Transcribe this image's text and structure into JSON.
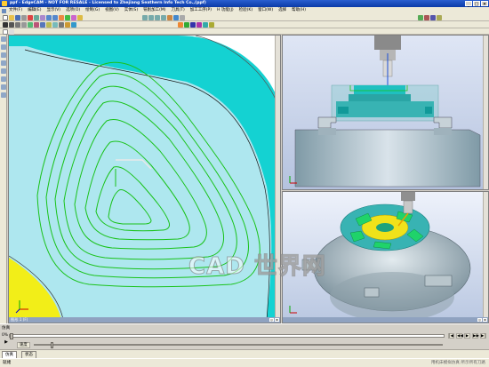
{
  "window": {
    "title": "ppf - EdgeCAM - NOT FOR RESALE - Licensed to Zhejiang Seathern Info Tech Co.,(ppf)",
    "controls": [
      "_",
      "□",
      "×"
    ]
  },
  "menubar": {
    "items": [
      "文件(F)",
      "编辑(E)",
      "显示(V)",
      "选项(O)",
      "绘制(G)",
      "视图(V)",
      "实体(S)",
      "铣削加工(M)",
      "刀具(T)",
      "加工工序(P)",
      "H 功能(J)",
      "检验(K)",
      "窗口(W)",
      "选择",
      "帮助(H)"
    ]
  },
  "viewports": {
    "left_label": "图形 1 (F)",
    "right_top_label": "",
    "right_bottom_label": ""
  },
  "simulation": {
    "title": "仿真",
    "progress_percent": "0%",
    "speed_label": "速度",
    "progress_fraction": 0.0,
    "speed_fraction": 0.04,
    "buttons": [
      "|◀",
      "◀◀",
      "▶",
      "▶▶",
      "▶|"
    ]
  },
  "bottom_tabs": [
    "仿真",
    "状态"
  ],
  "statusbar": {
    "text": "就绪",
    "right_text": "用机床模拟仿真 所示所有刀路"
  },
  "watermark": "CAD 世界网",
  "colors": {
    "titlebar": "#0a3aa8",
    "cyan": "#14d2d2",
    "toolpath": "#19c219",
    "stock_teal": "#4fb7b7"
  }
}
